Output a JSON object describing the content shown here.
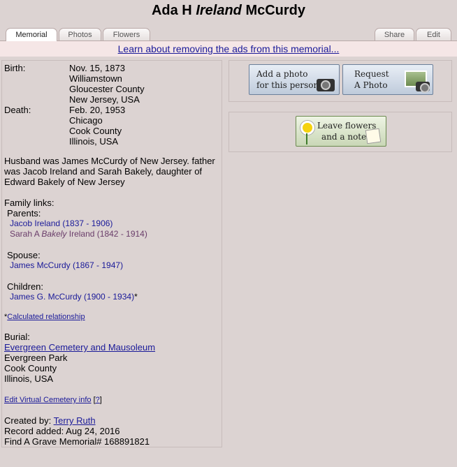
{
  "title": {
    "first": "Ada H",
    "maiden": "Ireland",
    "last": "McCurdy"
  },
  "tabs": {
    "memorial": "Memorial",
    "photos": "Photos",
    "flowers": "Flowers",
    "share": "Share",
    "edit": "Edit"
  },
  "ad_link": "Learn about removing the ads from this memorial...",
  "birth": {
    "label": "Birth:",
    "date": "Nov. 15, 1873",
    "city": "Williamstown",
    "county": "Gloucester County",
    "state": "New Jersey, USA"
  },
  "death": {
    "label": "Death:",
    "date": "Feb. 20, 1953",
    "city": "Chicago",
    "county": "Cook County",
    "state": "Illinois, USA"
  },
  "bio": {
    "line1": "Husband was James McCurdy of New Jersey. father",
    "line2": "was Jacob Ireland and Sarah Bakely, daughter of",
    "line3": "Edward Bakely of New Jersey"
  },
  "family": {
    "label": "Family links:",
    "parents_label": "Parents:",
    "parent1": "Jacob Ireland (1837 - 1906)",
    "parent2_first": "Sarah A",
    "parent2_maiden": "Bakely",
    "parent2_rest": "Ireland (1842 - 1914)",
    "spouse_label": "Spouse:",
    "spouse": "James McCurdy (1867 - 1947)",
    "children_label": "Children:",
    "child": "James G. McCurdy (1900 - 1934)",
    "child_mark": "*"
  },
  "calc": {
    "star": "*",
    "link": "Calculated relationship"
  },
  "burial": {
    "label": "Burial:",
    "cemetery": "Evergreen Cemetery and Mausoleum",
    "city": "Evergreen Park",
    "county": "Cook County",
    "state": "Illinois, USA"
  },
  "vcem": {
    "link": "Edit Virtual Cemetery info",
    "open": "[",
    "help": "?",
    "close": "]"
  },
  "record": {
    "created_label": "Created by:",
    "created_by": "Terry Ruth",
    "added": "Record added: Aug 24, 2016",
    "memorial_id": "Find A Grave Memorial# 168891821"
  },
  "buttons": {
    "add_photo_1": "Add a photo",
    "add_photo_2": "for this person",
    "request_1": "Request",
    "request_2": "A Photo",
    "flowers_1": "Leave flowers",
    "flowers_2": "and a note"
  }
}
